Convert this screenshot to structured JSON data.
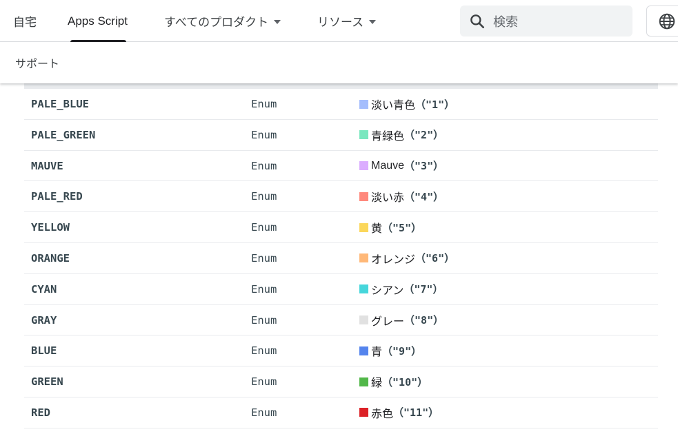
{
  "topnav": {
    "home": "自宅",
    "apps_script": "Apps Script",
    "all_products": "すべてのプロダクト",
    "resources": "リソース"
  },
  "search": {
    "placeholder": "検索"
  },
  "subnav": {
    "support": "サポート"
  },
  "rows": [
    {
      "name": "PALE_BLUE",
      "type": "Enum",
      "label": "淡い青色",
      "code": "（\"1\"）",
      "color": "#a4bdfc"
    },
    {
      "name": "PALE_GREEN",
      "type": "Enum",
      "label": "青緑色",
      "code": "（\"2\"）",
      "color": "#7ae7bf"
    },
    {
      "name": "MAUVE",
      "type": "Enum",
      "label": "Mauve",
      "code": "（\"3\"）",
      "color": "#dbadff"
    },
    {
      "name": "PALE_RED",
      "type": "Enum",
      "label": "淡い赤",
      "code": "（\"4\"）",
      "color": "#ff887c"
    },
    {
      "name": "YELLOW",
      "type": "Enum",
      "label": "黄",
      "code": "（\"5\"）",
      "color": "#fbd75b"
    },
    {
      "name": "ORANGE",
      "type": "Enum",
      "label": "オレンジ",
      "code": "（\"6\"）",
      "color": "#ffb878"
    },
    {
      "name": "CYAN",
      "type": "Enum",
      "label": "シアン",
      "code": "（\"7\"）",
      "color": "#46d6db"
    },
    {
      "name": "GRAY",
      "type": "Enum",
      "label": "グレー",
      "code": "（\"8\"）",
      "color": "#e1e1e1"
    },
    {
      "name": "BLUE",
      "type": "Enum",
      "label": "青",
      "code": "（\"9\"）",
      "color": "#5484ed"
    },
    {
      "name": "GREEN",
      "type": "Enum",
      "label": "緑",
      "code": "（\"10\"）",
      "color": "#51b749"
    },
    {
      "name": "RED",
      "type": "Enum",
      "label": "赤色",
      "code": "（\"11\"）",
      "color": "#dc2127"
    }
  ],
  "icons": {
    "search": "search-icon",
    "language": "globe-icon",
    "dropdown": "caret-down-icon"
  }
}
